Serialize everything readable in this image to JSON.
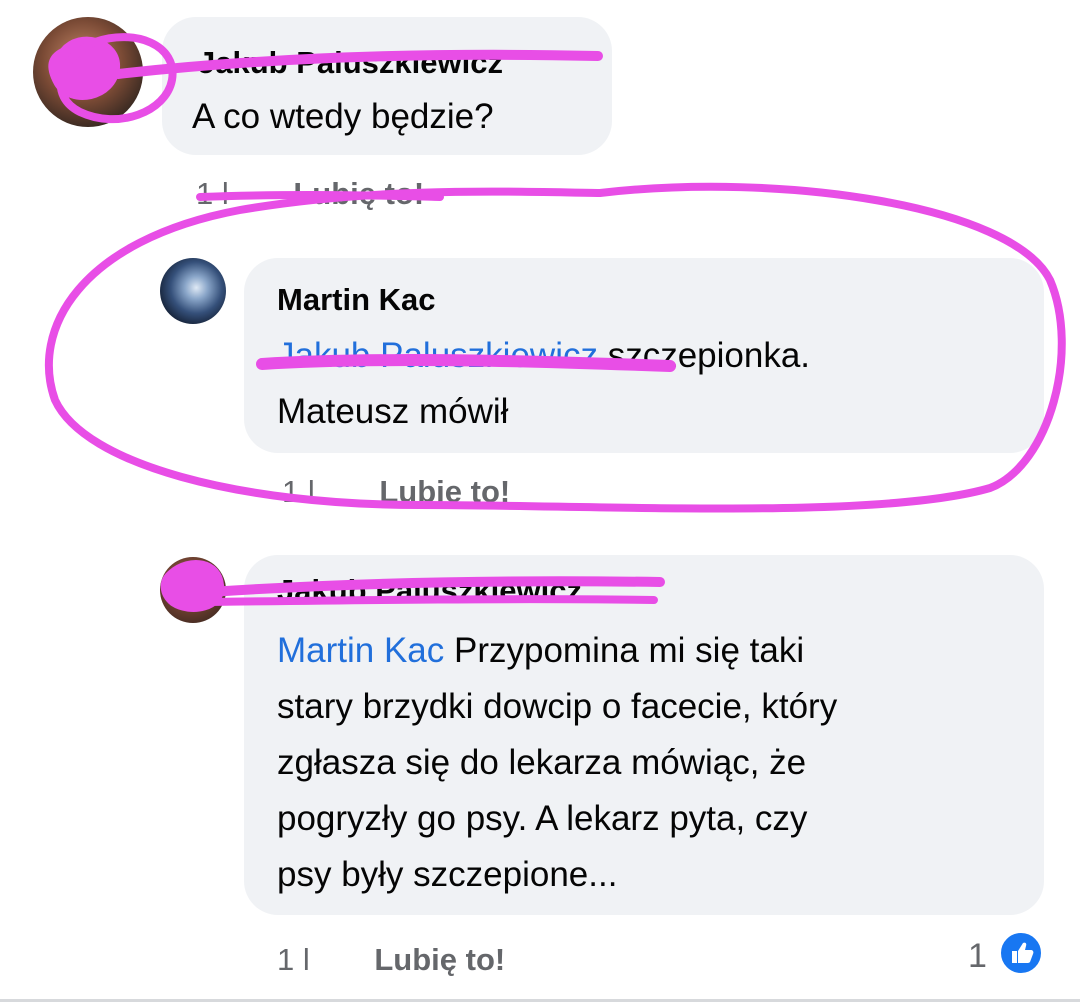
{
  "comments": [
    {
      "author": "Jakub Paluszkiewicz",
      "text": "A co wtedy będzie?",
      "time": "1 l",
      "like_label": "Lubię to!"
    },
    {
      "author": "Martin Kac",
      "mention": "Jakub Paluszkiewicz",
      "text_line1": " szczepionka.",
      "text_line2": "Mateusz mówił",
      "time": "1 l",
      "like_label": "Lubię to!"
    },
    {
      "author": "Jakub Paluszkiewicz",
      "mention": "Martin Kac",
      "text_line1": " Przypomina mi się taki",
      "text_rest": [
        "stary brzydki dowcip o facecie, który",
        "zgłasza się do lekarza mówiąc, że",
        "pogryzły go psy. A lekarz pyta, czy",
        "psy były szczepione..."
      ],
      "time": "1 l",
      "like_label": "Lubię to!",
      "reaction_count": "1"
    }
  ],
  "colors": {
    "bubble": "#f0f2f5",
    "mention": "#216fdb",
    "meta": "#65676b",
    "annotation": "#e84ee6",
    "like": "#1877f2"
  },
  "icons": {
    "reaction": "thumbs-up-icon"
  }
}
